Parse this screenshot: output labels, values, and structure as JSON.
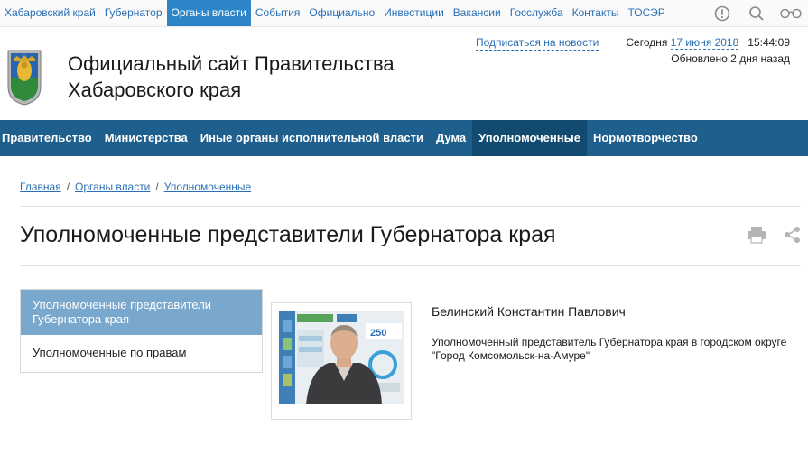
{
  "topnav": [
    {
      "label": "Хабаровский край",
      "active": false
    },
    {
      "label": "Губернатор",
      "active": false
    },
    {
      "label": "Органы власти",
      "active": true
    },
    {
      "label": "События",
      "active": false
    },
    {
      "label": "Официально",
      "active": false
    },
    {
      "label": "Инвестиции",
      "active": false
    },
    {
      "label": "Вакансии",
      "active": false
    },
    {
      "label": "Госслужба",
      "active": false
    },
    {
      "label": "Контакты",
      "active": false
    },
    {
      "label": "ТОСЭР",
      "active": false
    }
  ],
  "top_icons": [
    "info-icon",
    "search-icon",
    "glasses-icon"
  ],
  "header": {
    "title_line1": "Официальный сайт Правительства",
    "title_line2": "Хабаровского края",
    "subscribe": "Подписаться на новости",
    "today_label": "Сегодня",
    "date": "17 июня 2018",
    "time": "15:44:09",
    "updated": "Обновлено 2 дня назад"
  },
  "mainnav": [
    {
      "label": "Правительство",
      "active": false
    },
    {
      "label": "Министерства",
      "active": false
    },
    {
      "label": "Иные органы исполнительной власти",
      "active": false
    },
    {
      "label": "Дума",
      "active": false
    },
    {
      "label": "Уполномоченные",
      "active": true
    },
    {
      "label": "Нормотворчество",
      "active": false
    }
  ],
  "breadcrumb": [
    "Главная",
    "Органы власти",
    "Уполномоченные"
  ],
  "page_title": "Уполномоченные представители Губернатора края",
  "sidemenu": [
    {
      "label": "Уполномоченные представители Губернатора края",
      "active": true
    },
    {
      "label": "Уполномоченные по правам",
      "active": false
    }
  ],
  "person": {
    "name": "Белинский Константин Павлович",
    "description": "Уполномоченный представитель Губернатора края в городском округе \"Город Комсомольск-на-Амуре\""
  },
  "photo_text": {
    "number": "250"
  },
  "colors": {
    "link": "#2a6fb5",
    "top_active": "#2e86c8",
    "mainnav_bg": "#1f5f8d",
    "mainnav_active": "#134a6f",
    "side_active": "#7aa7cc"
  }
}
